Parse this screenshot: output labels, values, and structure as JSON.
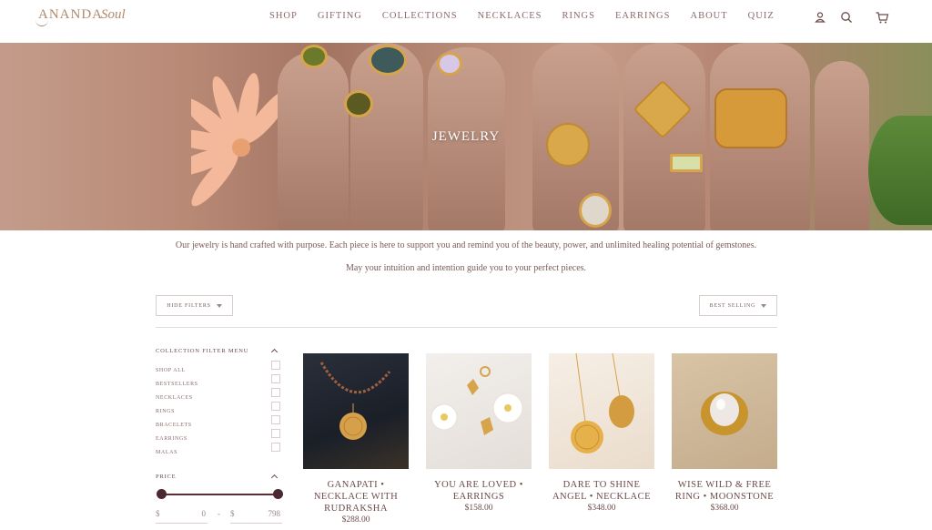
{
  "brand": {
    "name_main": "ANANDA",
    "name_script": "Soul"
  },
  "nav": [
    {
      "label": "SHOP"
    },
    {
      "label": "GIFTING"
    },
    {
      "label": "COLLECTIONS"
    },
    {
      "label": "NECKLACES"
    },
    {
      "label": "RINGS"
    },
    {
      "label": "EARRINGS"
    },
    {
      "label": "ABOUT"
    },
    {
      "label": "QUIZ"
    }
  ],
  "header_icons": [
    "account-icon",
    "search-icon",
    "cart-icon"
  ],
  "hero": {
    "title": "JEWELRY"
  },
  "intro": {
    "line1": "Our jewelry is hand crafted with purpose. Each piece is here to support you and remind you of the beauty, power, and unlimited healing potential of gemstones.",
    "line2": "May your intuition and intention guide you to your perfect pieces."
  },
  "toolbar": {
    "filter_button": "HIDE FILTERS",
    "sort_button": "BEST SELLING"
  },
  "sidebar": {
    "collection_title": "COLLECTION FILTER MENU",
    "items": [
      {
        "label": "SHOP ALL"
      },
      {
        "label": "BESTSELLERS"
      },
      {
        "label": "NECKLACES"
      },
      {
        "label": "RINGS"
      },
      {
        "label": "BRACELETS"
      },
      {
        "label": "EARRINGS"
      },
      {
        "label": "MALAS"
      }
    ],
    "price_title": "PRICE",
    "price": {
      "currency": "$",
      "min": "0",
      "max": "798"
    }
  },
  "products": [
    {
      "name": "GANAPATI • NECKLACE WITH RUDRAKSHA",
      "price": "$288.00"
    },
    {
      "name": "YOU ARE LOVED • EARRINGS",
      "price": "$158.00"
    },
    {
      "name": "DARE TO SHINE ANGEL • NECKLACE",
      "price": "$348.00"
    },
    {
      "name": "WISE WILD & FREE RING • MOONSTONE",
      "price": "$368.00"
    }
  ],
  "colors": {
    "accent": "#6b4a48",
    "slider": "#5a2c36",
    "gold": "#d6a44a"
  }
}
